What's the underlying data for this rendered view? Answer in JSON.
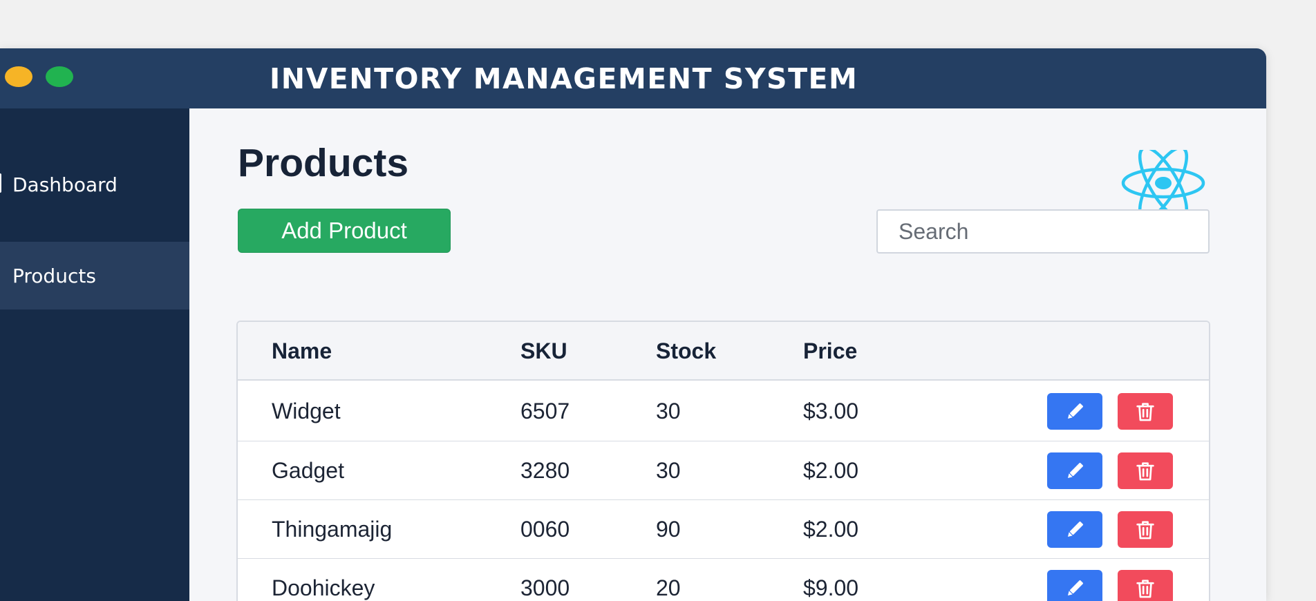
{
  "window": {
    "title": "INVENTORY MANAGEMENT SYSTEM",
    "controls": [
      "minimize-dot",
      "maximize-dot"
    ]
  },
  "sidebar": {
    "items": [
      {
        "label": "Dashboard",
        "active": false
      },
      {
        "label": "Products",
        "active": true
      }
    ]
  },
  "main": {
    "title": "Products",
    "logo_icon": "react-atom-icon",
    "add_button_label": "Add Product",
    "search": {
      "placeholder": "Search",
      "value": ""
    }
  },
  "table": {
    "columns": [
      "Name",
      "SKU",
      "Stock",
      "Price"
    ],
    "rows": [
      {
        "name": "Widget",
        "sku": "6507",
        "stock": "30",
        "price": "$3.00"
      },
      {
        "name": "Gadget",
        "sku": "3280",
        "stock": "30",
        "price": "$2.00"
      },
      {
        "name": "Thingamajig",
        "sku": "0060",
        "stock": "90",
        "price": "$2.00"
      },
      {
        "name": "Doohickey",
        "sku": "3000",
        "stock": "20",
        "price": "$9.00"
      }
    ],
    "row_actions": {
      "edit_icon": "pencil-icon",
      "delete_icon": "trash-icon"
    }
  },
  "colors": {
    "titlebar": "#243f63",
    "sidebar": "#162b48",
    "sidebar_active": "#283e5e",
    "add_button": "#27a961",
    "edit_button": "#3576f2",
    "delete_button": "#f24b5c",
    "react_logo": "#2dc6f2"
  }
}
